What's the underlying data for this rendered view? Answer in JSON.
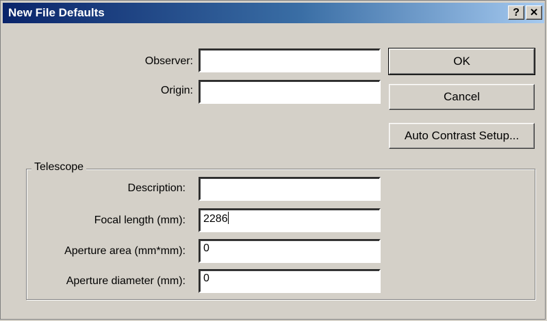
{
  "window": {
    "title": "New File Defaults",
    "help_label": "?",
    "close_label": "✕"
  },
  "fields": {
    "observer": {
      "label": "Observer:",
      "value": ""
    },
    "origin": {
      "label": "Origin:",
      "value": ""
    }
  },
  "buttons": {
    "ok": "OK",
    "cancel": "Cancel",
    "auto_contrast": "Auto Contrast Setup..."
  },
  "telescope": {
    "group_label": "Telescope",
    "description": {
      "label": "Description:",
      "value": ""
    },
    "focal_length": {
      "label": "Focal length (mm):",
      "value": "2286"
    },
    "aperture_area": {
      "label": "Aperture area (mm*mm):",
      "value": "0"
    },
    "aperture_diameter": {
      "label": "Aperture diameter (mm):",
      "value": "0"
    }
  }
}
